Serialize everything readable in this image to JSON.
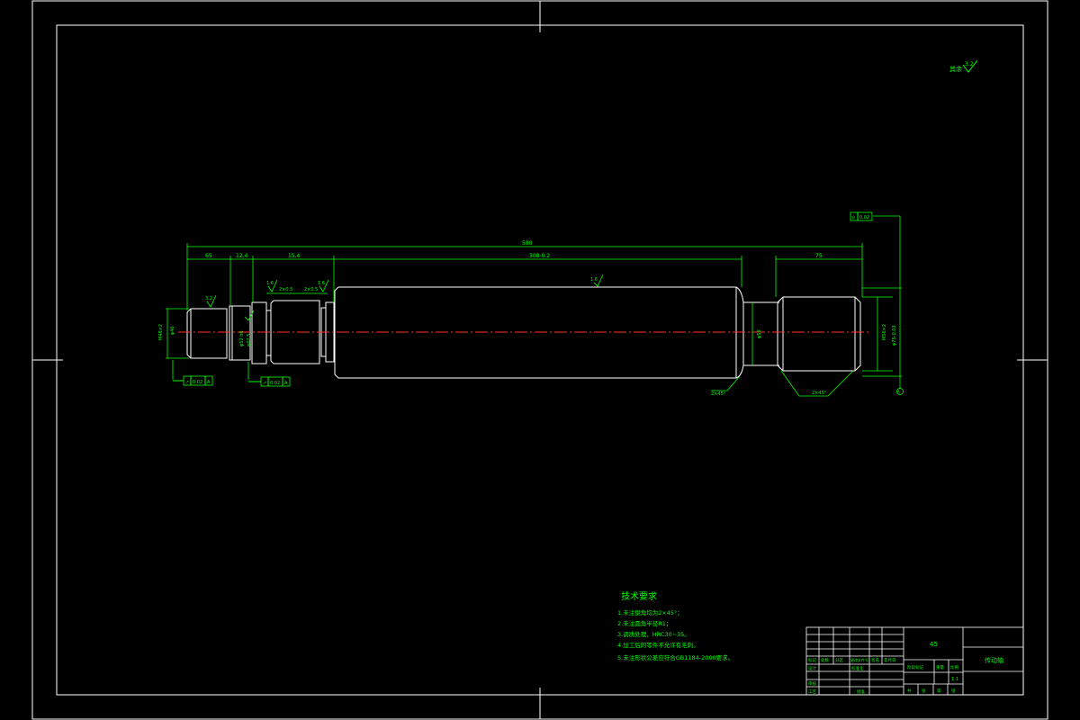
{
  "drawing": {
    "roughness_other": "其余",
    "roughness_main": "3.2",
    "dims": {
      "overall": "580",
      "d1": "65",
      "d2": "12.4",
      "d3": "15.4",
      "d4": "308-0.2",
      "d5": "75",
      "groove1": "1.6",
      "groove2": "1.6",
      "groove3": "1.6",
      "gw1": "2×0.5",
      "gw2": "2×0.5",
      "ra1": "3.2",
      "ra2": "1.6",
      "left_dia": "M48×2",
      "left_dia2": "φ46",
      "mid_dia": "φ52 h6",
      "mid_dia2": "φ62.5",
      "right_dia": "φ58",
      "right_thread": "M56×2",
      "right_tol": "φ75-0.03",
      "chamfer1": "2×45°",
      "chamfer2": "2×45°"
    },
    "tol_frames": {
      "f1_sym": "↗",
      "f1_val": "0.02",
      "f1_ref": "A",
      "f2_sym": "↗",
      "f2_val": "0.02",
      "f2_ref": "A",
      "f3_sym": "◎",
      "f3_val": "0.02",
      "datum": "A"
    }
  },
  "notes": {
    "title": "技术要求",
    "items": [
      "1.未注倒角均为2×45°；",
      "2.未注圆角半径R1；",
      "3.调质处理，HRC30~35。",
      "4.加工后的零件不允许有毛刺。",
      "5.未注形状公差应符合GB1184-2000要求。"
    ]
  },
  "title_block": {
    "material": "45",
    "part_name": "传动轴",
    "scale": "1:1",
    "cells": [
      "标记",
      "处数",
      "分区",
      "更改文件号",
      "签名",
      "年月日",
      "设计",
      "标准化",
      "阶段标记",
      "重量",
      "比例",
      "审核",
      "工艺",
      "批准",
      "共",
      "张",
      "第",
      "张"
    ]
  }
}
